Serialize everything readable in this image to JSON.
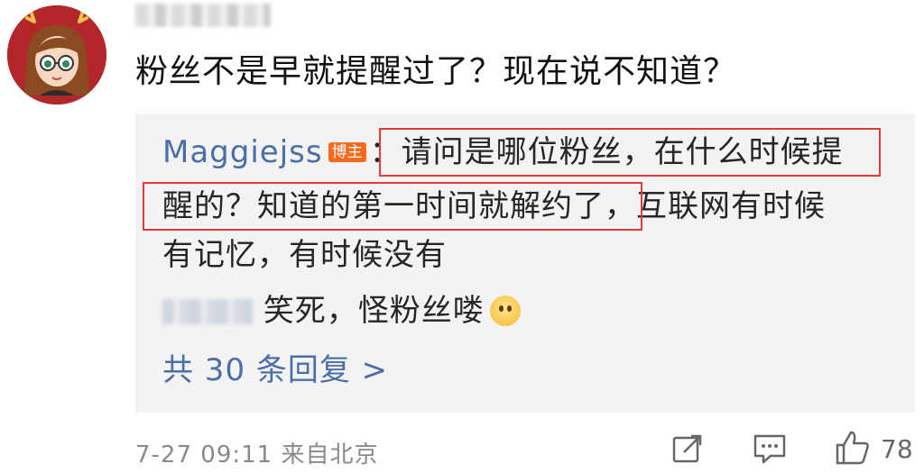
{
  "comment": {
    "text": "粉丝不是早就提醒过了？现在说不知道？"
  },
  "reply": {
    "author": "Maggiejss",
    "badge": "博主",
    "line1": "：请问是哪位粉丝，在什么时候提",
    "line2": "醒的？知道的第一时间就解约了，互联网有时候",
    "line3": "有记忆，有时候没有",
    "second_reply_text": "笑死，怪粉丝喽",
    "more_link": "共 30 条回复 >"
  },
  "footer": {
    "time": "7-27 09:11",
    "location": "来自北京",
    "likes": "78"
  },
  "icons": {
    "share": "share-icon",
    "comment": "comment-icon",
    "like": "thumbs-up-icon",
    "avatar_ears": "reindeer-antlers"
  },
  "colors": {
    "author": "#4a6fa8",
    "badge": "#f56a1d",
    "highlight": "#e53935",
    "reply_bg": "#f3f3f3"
  }
}
